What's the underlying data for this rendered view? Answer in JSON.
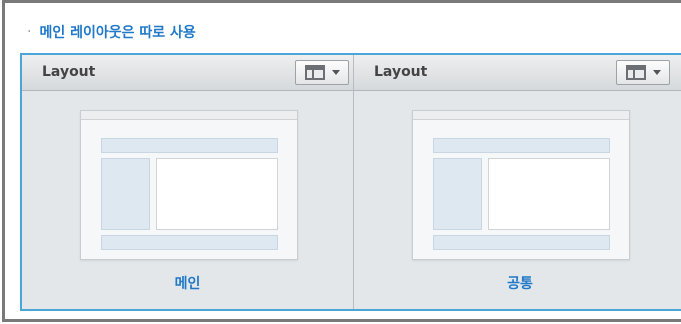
{
  "section": {
    "bullet": "·",
    "title": "메인 레이아웃은 따로 사용"
  },
  "columns": [
    {
      "header": "Layout",
      "label": "메인"
    },
    {
      "header": "Layout",
      "label": "공통"
    }
  ],
  "icons": {
    "layout_button": "layout-grid-icon",
    "dropdown": "chevron-down-icon"
  },
  "colors": {
    "accent": "#1f78c8",
    "panel_border": "#4aa6d6"
  }
}
